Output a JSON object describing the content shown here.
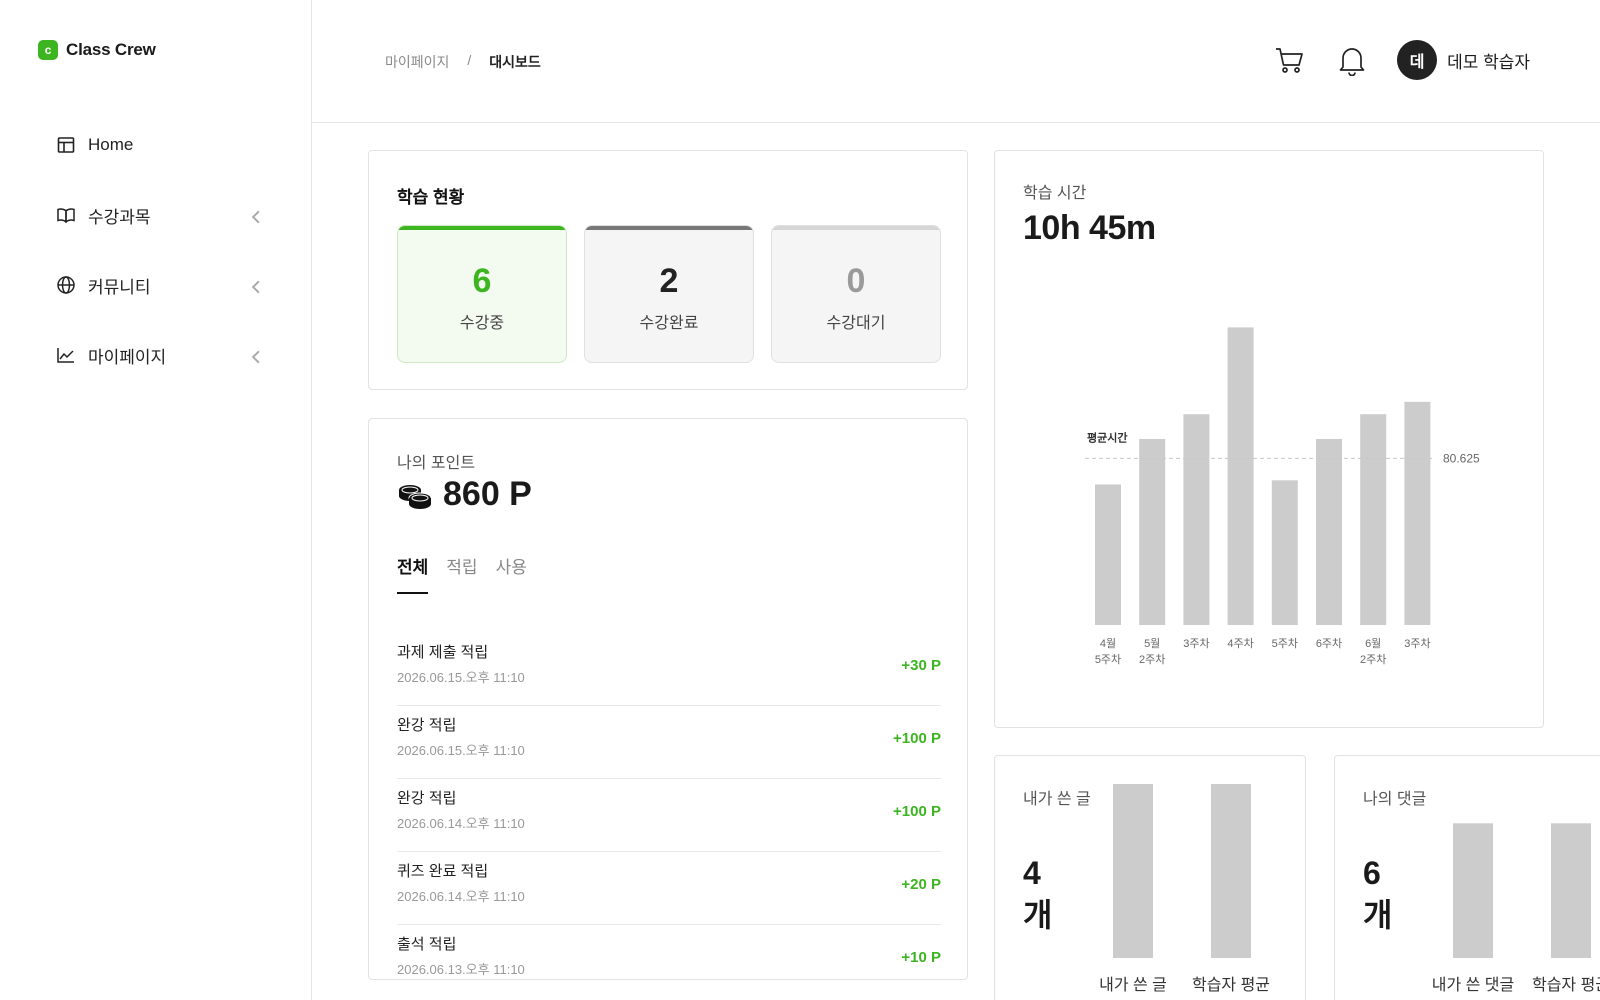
{
  "app": {
    "logo_letter": "c",
    "name": "Class Crew"
  },
  "sidebar": {
    "items": [
      {
        "label": "Home",
        "icon": "layout-icon"
      },
      {
        "label": "수강과목",
        "icon": "book-icon"
      },
      {
        "label": "커뮤니티",
        "icon": "globe-icon"
      },
      {
        "label": "마이페이지",
        "icon": "chart-line-icon"
      }
    ]
  },
  "header": {
    "breadcrumb": [
      "마이페이지",
      "/",
      "대시보드"
    ],
    "user_initial": "데",
    "user_name": "데모 학습자"
  },
  "status": {
    "title": "학습 현황",
    "stats": [
      {
        "value": "6",
        "label": "수강중",
        "bar_color": "#3cb521",
        "num_color": "#3cb521"
      },
      {
        "value": "2",
        "label": "수강완료",
        "bar_color": "#777777",
        "num_color": "#222222"
      },
      {
        "value": "0",
        "label": "수강대기",
        "bar_color": "#d6d6d6",
        "num_color": "#9a9a9a"
      }
    ]
  },
  "points": {
    "title": "나의 포인트",
    "total": "860 P",
    "tabs": [
      "전체",
      "적립",
      "사용"
    ],
    "history": [
      {
        "title": "과제 제출 적립",
        "date": "2026.06.15.오후 11:10",
        "amount": "+30 P"
      },
      {
        "title": "완강 적립",
        "date": "2026.06.15.오후 11:10",
        "amount": "+100 P"
      },
      {
        "title": "완강 적립",
        "date": "2026.06.14.오후 11:10",
        "amount": "+100 P"
      },
      {
        "title": "퀴즈 완료 적립",
        "date": "2026.06.14.오후 11:10",
        "amount": "+20 P"
      },
      {
        "title": "출석 적립",
        "date": "2026.06.13.오후 11:10",
        "amount": "+10 P"
      }
    ]
  },
  "study_time": {
    "title": "학습 시간",
    "total": "10h 45m"
  },
  "chart_data": [
    {
      "type": "bar",
      "categories": [
        [
          "4월",
          "5주차"
        ],
        [
          "5월",
          "2주차"
        ],
        [
          "3주차"
        ],
        [
          "4주차"
        ],
        [
          "5주차"
        ],
        [
          "6주차"
        ],
        [
          "6월",
          "2주차"
        ],
        [
          "3주차"
        ]
      ],
      "values": [
        68,
        90,
        102,
        144,
        70,
        90,
        102,
        108
      ],
      "ylim": [
        0,
        150
      ],
      "average": {
        "label": "평균시간",
        "value": 80.625,
        "value_label": "80.625"
      },
      "bar_color": "#cccccc"
    },
    {
      "type": "bar",
      "title": "내가 쓴 글",
      "summary": "4 개",
      "categories": [
        "내가 쓴 글",
        "학습자 평균"
      ],
      "values": [
        4,
        4
      ],
      "ylim": [
        0,
        4
      ],
      "bar_color": "#cccccc"
    },
    {
      "type": "bar",
      "title": "나의 댓글",
      "summary": "6 개",
      "categories": [
        "내가 쓴 댓글",
        "학습자 평균"
      ],
      "values": [
        6,
        6
      ],
      "ylim": [
        0,
        7.75
      ],
      "bar_color": "#cccccc"
    }
  ]
}
